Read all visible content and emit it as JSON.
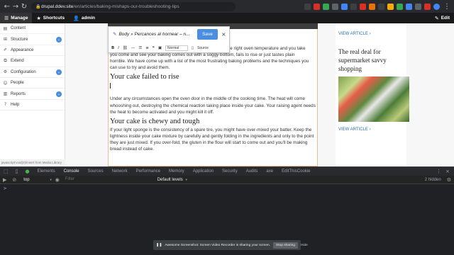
{
  "browser": {
    "url_host": "drupal.ddev.site",
    "url_path": "/en/articles/baking-mishaps-our-troubleshooting-tips"
  },
  "admin_toolbar": {
    "manage": "Manage",
    "shortcuts": "Shortcuts",
    "user": "admin",
    "edit": "Edit"
  },
  "sidebar": {
    "items": [
      {
        "label": "Content"
      },
      {
        "label": "Structure"
      },
      {
        "label": "Appearance"
      },
      {
        "label": "Extend"
      },
      {
        "label": "Configuration"
      },
      {
        "label": "People"
      },
      {
        "label": "Reports"
      },
      {
        "label": "Help"
      }
    ]
  },
  "editor": {
    "field_title": "Body » Percances al hornear – n...",
    "save_label": "Save",
    "format_select": "Normal",
    "source_label": "Source"
  },
  "article": {
    "intro_line1": "the right oven temperature and you take",
    "intro_line2": "you come and see your baking comes out with a soggy bottom, fails to rise or just tastes plain",
    "intro_line3": "horrible. We have come up with a list of the most frustrating baking problems and the techniques you",
    "intro_line4": "can use to try and avoid them.",
    "heading1": "Your cake failed to rise",
    "para1": "Under any circumstances open the oven door in the middle of the cooking time. The heat will come whooshing out, destroying the chemical reaction taking place inside your cake. Your raising agent needs the heat to become activated and you might kill it off.",
    "heading2": "Your cake is chewy and tough",
    "para2": "If your light sponge is the consistency of a spare tire, you might have over-mixed your batter. Keep the lightness inside your cake mixture by carefully and gently folding in the ingredients and only to the point they are just mixed. If you over-fold, the gluten in the flour will start to come out and you'll be making bread instead of cake."
  },
  "aside": {
    "view_article_1": "VIEW ARTICLE",
    "promo_title": "The real deal for supermarket savvy shopping",
    "view_article_2": "VIEW ARTICLE"
  },
  "status_path": "javascript:void(0)/insert from Media Library",
  "devtools": {
    "tabs": [
      "Elements",
      "Console",
      "Sources",
      "Network",
      "Performance",
      "Memory",
      "Application",
      "Security",
      "Audits",
      "axe",
      "EditThisCookie"
    ],
    "active_tab": "Console",
    "context": "top",
    "filter_placeholder": "Filter",
    "levels": "Default levels",
    "hidden": "2 hidden",
    "prompt": ">"
  },
  "share_notice": {
    "text": "Awesome Screenshot: Screen Video Recorder is sharing your screen.",
    "stop_label": "Stop sharing",
    "hide_label": "Hide"
  }
}
